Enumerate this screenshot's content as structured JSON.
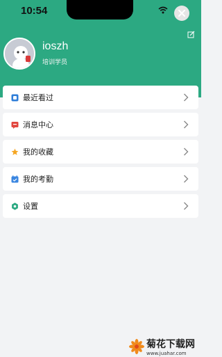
{
  "status_bar": {
    "time": "10:54"
  },
  "profile": {
    "username": "ioszh",
    "role": "培训学员"
  },
  "menu": [
    {
      "label": "最近看过",
      "icon": "history-icon",
      "icon_color": "#2f7ed8"
    },
    {
      "label": "消息中心",
      "icon": "message-icon",
      "icon_color": "#e2463f"
    },
    {
      "label": "我的收藏",
      "icon": "star-icon",
      "icon_color": "#f5a623"
    },
    {
      "label": "我的考勤",
      "icon": "attendance-icon",
      "icon_color": "#3a86e0"
    },
    {
      "label": "设置",
      "icon": "settings-icon",
      "icon_color": "#2ca982"
    }
  ],
  "watermark": {
    "title": "菊花下载网",
    "url": "www.juahar.com"
  },
  "colors": {
    "header": "#2ca982",
    "background": "#f2f3f5"
  }
}
